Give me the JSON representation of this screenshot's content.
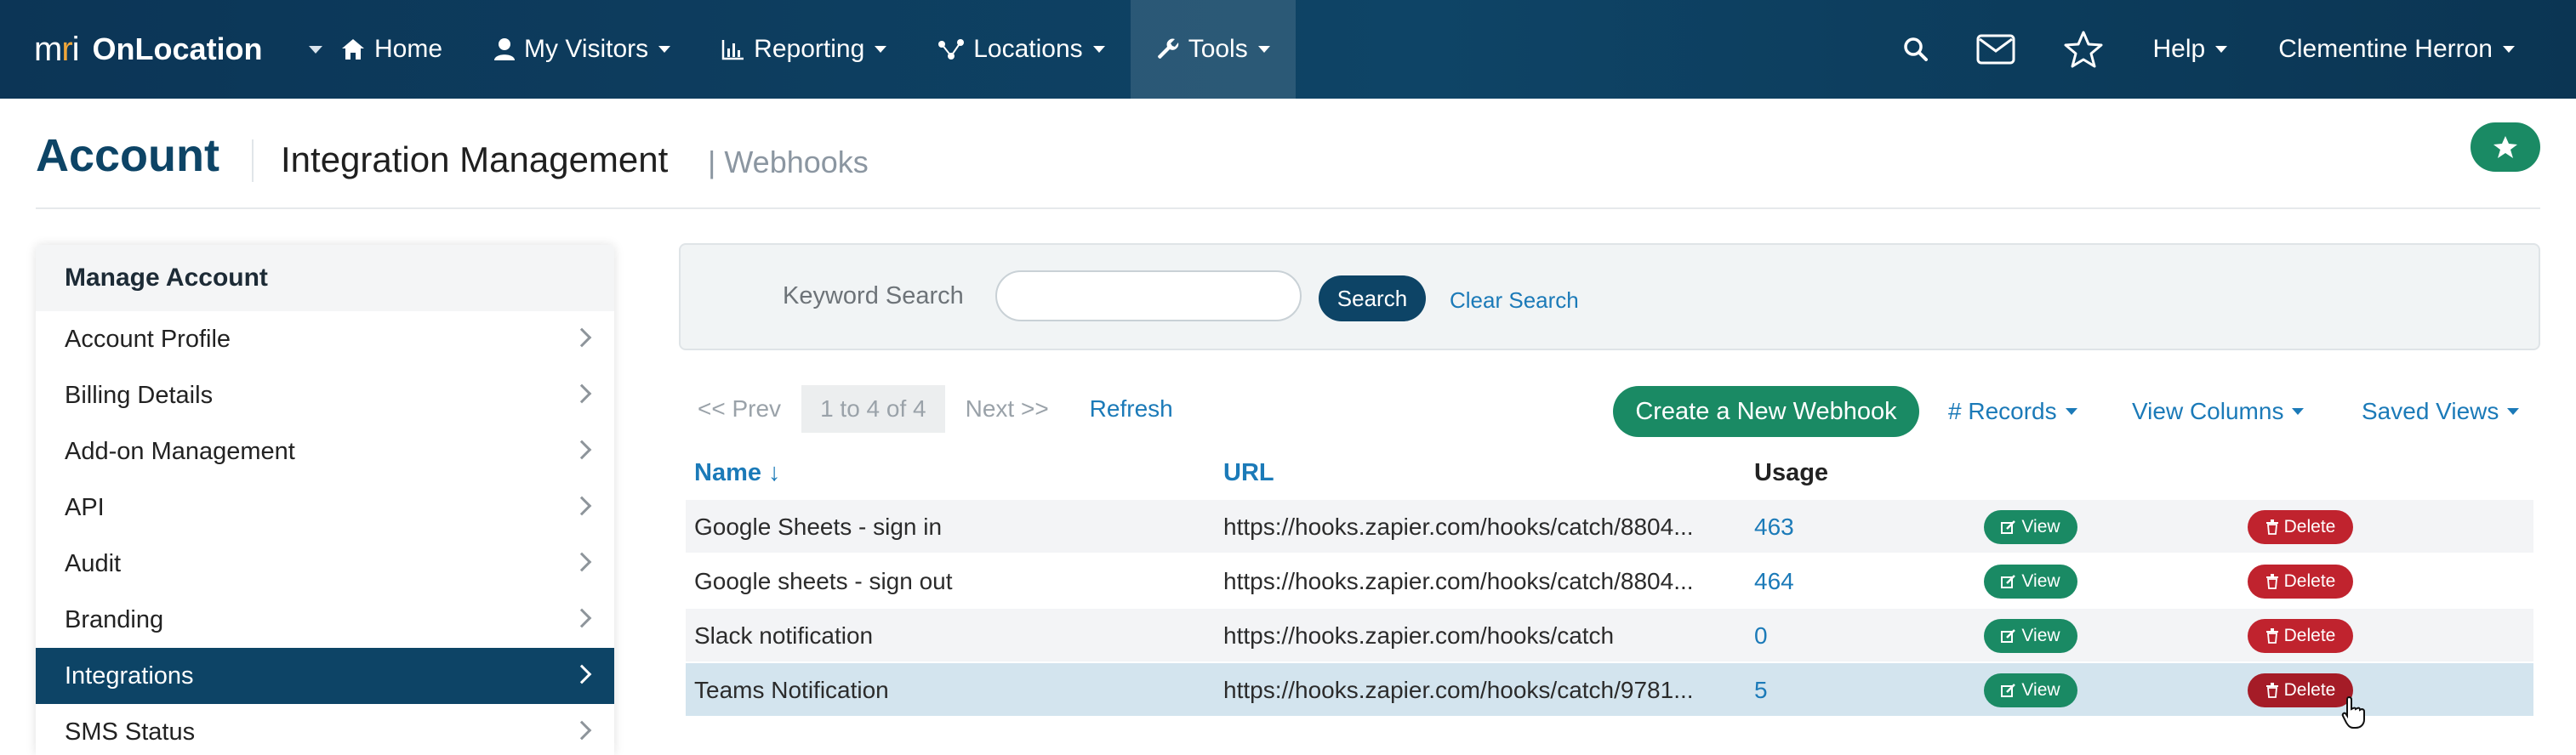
{
  "nav": {
    "brand_mark": "mri",
    "brand_name": "OnLocation",
    "items": [
      {
        "label": "Home",
        "icon": "home-icon"
      },
      {
        "label": "My Visitors",
        "icon": "user-icon"
      },
      {
        "label": "Reporting",
        "icon": "bar-chart-icon"
      },
      {
        "label": "Locations",
        "icon": "network-icon"
      },
      {
        "label": "Tools",
        "icon": "wrench-icon"
      }
    ],
    "right": {
      "help_label": "Help",
      "user_name": "Clementine Herron"
    }
  },
  "header": {
    "title": "Account",
    "section": "Integration Management",
    "subsection": "| Webhooks"
  },
  "sidebar": {
    "heading": "Manage Account",
    "items": [
      {
        "label": "Account Profile"
      },
      {
        "label": "Billing Details"
      },
      {
        "label": "Add-on Management"
      },
      {
        "label": "API"
      },
      {
        "label": "Audit"
      },
      {
        "label": "Branding"
      },
      {
        "label": "Integrations"
      },
      {
        "label": "SMS Status"
      }
    ],
    "active_item": "Integrations"
  },
  "search": {
    "label": "Keyword Search",
    "value": "",
    "button_label": "Search",
    "clear_label": "Clear Search"
  },
  "pager": {
    "prev": "<< Prev",
    "count": "1 to 4 of 4",
    "next": "Next >>",
    "refresh": "Refresh"
  },
  "toolbar": {
    "create_label": "Create a New Webhook",
    "records_label": "# Records",
    "columns_label": "View Columns",
    "views_label": "Saved Views"
  },
  "table": {
    "columns": {
      "name": "Name ↓",
      "url": "URL",
      "usage": "Usage"
    },
    "view_label": "View",
    "delete_label": "Delete",
    "rows": [
      {
        "name": "Google Sheets - sign in",
        "url": "https://hooks.zapier.com/hooks/catch/8804...",
        "usage": "463"
      },
      {
        "name": "Google sheets - sign out",
        "url": "https://hooks.zapier.com/hooks/catch/8804...",
        "usage": "464"
      },
      {
        "name": "Slack notification",
        "url": "https://hooks.zapier.com/hooks/catch",
        "usage": "0"
      },
      {
        "name": "Teams Notification",
        "url": "https://hooks.zapier.com/hooks/catch/9781...",
        "usage": "5"
      }
    ]
  },
  "colors": {
    "nav_bg": "#0c3556",
    "brand_accent": "#f0a63a",
    "primary": "#0d4466",
    "success": "#1a8a64",
    "danger": "#c0232e",
    "link": "#1b7ab8"
  }
}
